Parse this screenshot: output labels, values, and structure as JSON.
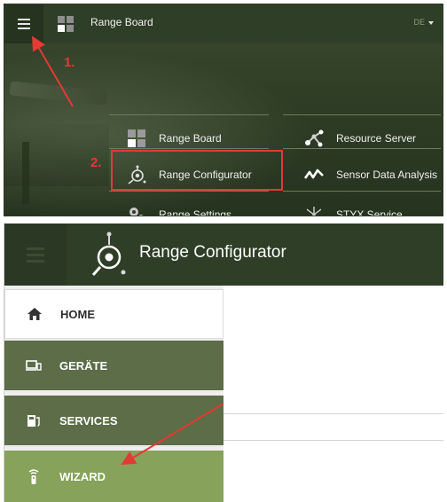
{
  "top": {
    "app_title": "Range Board",
    "language": "DE",
    "apps": [
      {
        "label": "Range Board",
        "icon": "grid-icon"
      },
      {
        "label": "Resource Server",
        "icon": "nodes-icon"
      },
      {
        "label": "Range Configurator",
        "icon": "configurator-icon"
      },
      {
        "label": "Sensor Data Analysis",
        "icon": "analysis-wave-icon"
      },
      {
        "label": "Range Settings",
        "icon": "gears-icon"
      },
      {
        "label": "STYX Service",
        "icon": "styx-icon"
      }
    ],
    "annotations": [
      "1.",
      "2."
    ]
  },
  "bottom": {
    "title": "Range Configurator",
    "nav": [
      {
        "label": "HOME",
        "icon": "home-icon"
      },
      {
        "label": "GERÄTE",
        "icon": "devices-icon"
      },
      {
        "label": "SERVICES",
        "icon": "services-icon"
      },
      {
        "label": "WIZARD",
        "icon": "remote-wizard-icon"
      }
    ]
  },
  "colors": {
    "header": "#2f3e27",
    "nav_dark": "#5c6d47",
    "nav_active": "#86a25b",
    "annotation": "#e53935"
  }
}
